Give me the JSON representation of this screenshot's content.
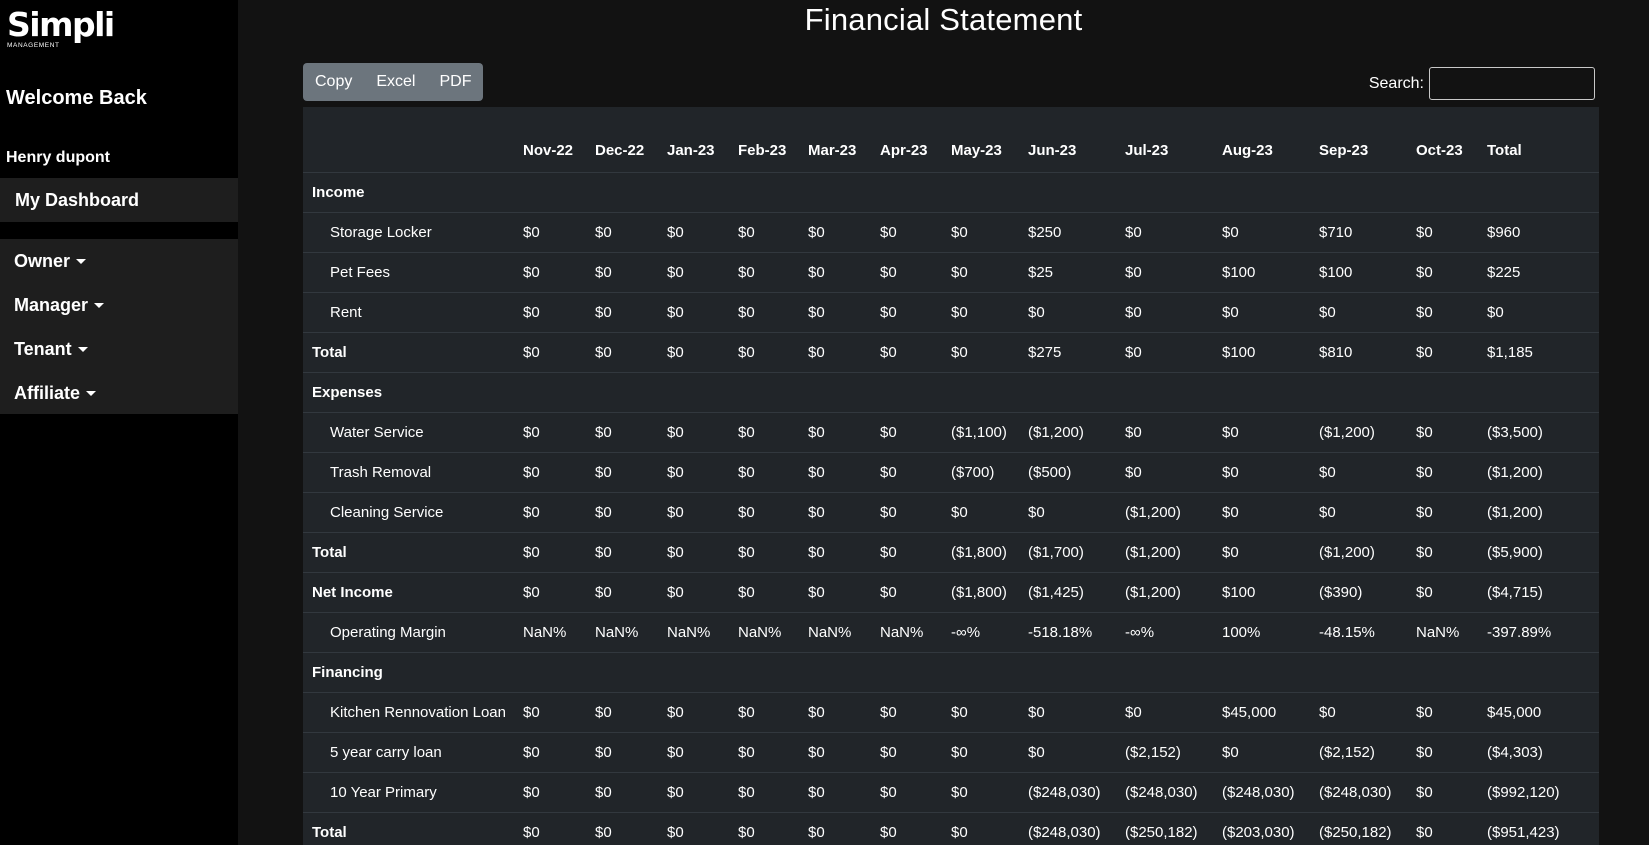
{
  "sidebar": {
    "logo_word": "Simpli",
    "logo_sub": "MANAGEMENT",
    "welcome": "Welcome Back",
    "username": "Henry dupont",
    "dashboard": "My Dashboard",
    "menu": [
      "Owner",
      "Manager",
      "Tenant",
      "Affiliate"
    ]
  },
  "page_title": "Financial Statement",
  "toolbar": {
    "copy": "Copy",
    "excel": "Excel",
    "pdf": "PDF",
    "search_label": "Search:",
    "search_value": ""
  },
  "table": {
    "columns": [
      "",
      "Nov-22",
      "Dec-22",
      "Jan-23",
      "Feb-23",
      "Mar-23",
      "Apr-23",
      "May-23",
      "Jun-23",
      "Jul-23",
      "Aug-23",
      "Sep-23",
      "Oct-23",
      "Total"
    ],
    "rows": [
      {
        "kind": "section",
        "label": "Income",
        "cells": []
      },
      {
        "kind": "item",
        "label": "Storage Locker",
        "cells": [
          "$0",
          "$0",
          "$0",
          "$0",
          "$0",
          "$0",
          "$0",
          "$250",
          "$0",
          "$0",
          "$710",
          "$0",
          "$960"
        ]
      },
      {
        "kind": "item",
        "label": "Pet Fees",
        "cells": [
          "$0",
          "$0",
          "$0",
          "$0",
          "$0",
          "$0",
          "$0",
          "$25",
          "$0",
          "$100",
          "$100",
          "$0",
          "$225"
        ]
      },
      {
        "kind": "item",
        "label": "Rent",
        "cells": [
          "$0",
          "$0",
          "$0",
          "$0",
          "$0",
          "$0",
          "$0",
          "$0",
          "$0",
          "$0",
          "$0",
          "$0",
          "$0"
        ]
      },
      {
        "kind": "total",
        "label": "Total",
        "cells": [
          "$0",
          "$0",
          "$0",
          "$0",
          "$0",
          "$0",
          "$0",
          "$275",
          "$0",
          "$100",
          "$810",
          "$0",
          "$1,185"
        ]
      },
      {
        "kind": "section",
        "label": "Expenses",
        "cells": []
      },
      {
        "kind": "item",
        "label": "Water Service",
        "cells": [
          "$0",
          "$0",
          "$0",
          "$0",
          "$0",
          "$0",
          "($1,100)",
          "($1,200)",
          "$0",
          "$0",
          "($1,200)",
          "$0",
          "($3,500)"
        ]
      },
      {
        "kind": "item",
        "label": "Trash Removal",
        "cells": [
          "$0",
          "$0",
          "$0",
          "$0",
          "$0",
          "$0",
          "($700)",
          "($500)",
          "$0",
          "$0",
          "$0",
          "$0",
          "($1,200)"
        ]
      },
      {
        "kind": "item",
        "label": "Cleaning Service",
        "cells": [
          "$0",
          "$0",
          "$0",
          "$0",
          "$0",
          "$0",
          "$0",
          "$0",
          "($1,200)",
          "$0",
          "$0",
          "$0",
          "($1,200)"
        ]
      },
      {
        "kind": "total",
        "label": "Total",
        "cells": [
          "$0",
          "$0",
          "$0",
          "$0",
          "$0",
          "$0",
          "($1,800)",
          "($1,700)",
          "($1,200)",
          "$0",
          "($1,200)",
          "$0",
          "($5,900)"
        ]
      },
      {
        "kind": "total",
        "label": "Net Income",
        "cells": [
          "$0",
          "$0",
          "$0",
          "$0",
          "$0",
          "$0",
          "($1,800)",
          "($1,425)",
          "($1,200)",
          "$100",
          "($390)",
          "$0",
          "($4,715)"
        ]
      },
      {
        "kind": "item",
        "label": "Operating Margin",
        "cells": [
          "NaN%",
          "NaN%",
          "NaN%",
          "NaN%",
          "NaN%",
          "NaN%",
          "-∞%",
          "-518.18%",
          "-∞%",
          "100%",
          "-48.15%",
          "NaN%",
          "-397.89%"
        ]
      },
      {
        "kind": "section",
        "label": "Financing",
        "cells": []
      },
      {
        "kind": "item",
        "label": "Kitchen Rennovation Loan",
        "cells": [
          "$0",
          "$0",
          "$0",
          "$0",
          "$0",
          "$0",
          "$0",
          "$0",
          "$0",
          "$45,000",
          "$0",
          "$0",
          "$45,000"
        ]
      },
      {
        "kind": "item",
        "label": "5 year carry loan",
        "cells": [
          "$0",
          "$0",
          "$0",
          "$0",
          "$0",
          "$0",
          "$0",
          "$0",
          "($2,152)",
          "$0",
          "($2,152)",
          "$0",
          "($4,303)"
        ]
      },
      {
        "kind": "item",
        "label": "10 Year Primary",
        "cells": [
          "$0",
          "$0",
          "$0",
          "$0",
          "$0",
          "$0",
          "$0",
          "($248,030)",
          "($248,030)",
          "($248,030)",
          "($248,030)",
          "$0",
          "($992,120)"
        ]
      },
      {
        "kind": "total",
        "label": "Total",
        "cells": [
          "$0",
          "$0",
          "$0",
          "$0",
          "$0",
          "$0",
          "$0",
          "($248,030)",
          "($250,182)",
          "($203,030)",
          "($250,182)",
          "$0",
          "($951,423)"
        ]
      }
    ]
  }
}
